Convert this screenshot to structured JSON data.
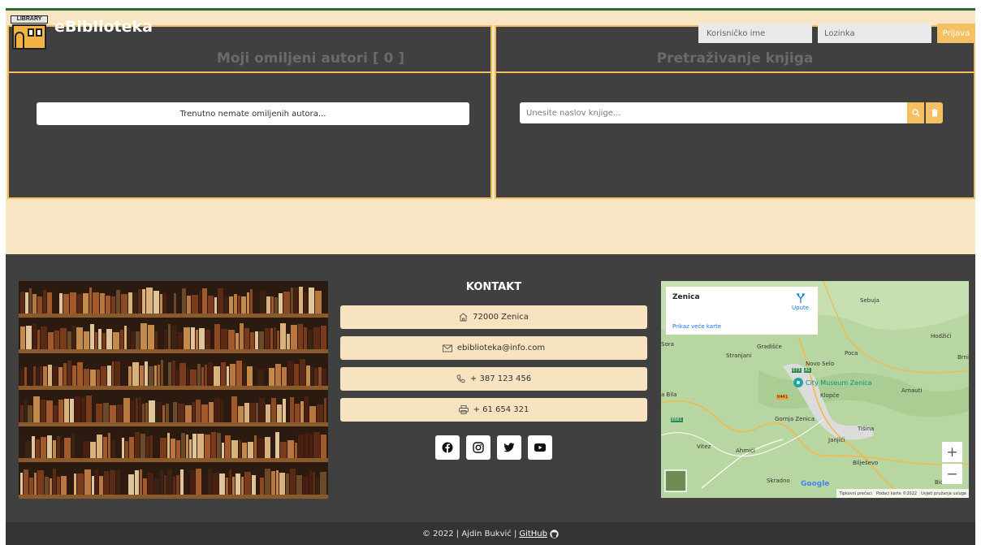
{
  "brand": {
    "logo_tag": "LIBRARY",
    "name": "eBiblioteka"
  },
  "login": {
    "username_placeholder": "Korisničko ime",
    "password_placeholder": "Lozinka",
    "button": "Prijava"
  },
  "favorites": {
    "title": "Moji omiljeni autori [ 0 ]",
    "empty_message": "Trenutno nemate omiljenih autora..."
  },
  "search": {
    "title": "Pretraživanje knjiga",
    "placeholder": "Unesite naslov knjige...",
    "search_icon": "search-icon",
    "clear_icon": "trash-icon"
  },
  "contact": {
    "title": "KONTAKT",
    "items": [
      {
        "icon": "home-icon",
        "text": "72000 Zenica"
      },
      {
        "icon": "envelope-icon",
        "text": "ebiblioteka@info.com"
      },
      {
        "icon": "phone-icon",
        "text": "+ 387 123 456"
      },
      {
        "icon": "printer-icon",
        "text": "+ 61 654 321"
      }
    ],
    "socials": [
      "facebook-icon",
      "instagram-icon",
      "twitter-icon",
      "youtube-icon"
    ]
  },
  "map": {
    "place": "Zenica",
    "directions": "Upute",
    "larger_map": "Prikaz veće karte",
    "labels": {
      "sebuja": "Sebuja",
      "hodzici": "Hodžići",
      "brni": "Brni",
      "sora": "Sora",
      "stranjani": "Stranjani",
      "gradisce": "Gradišće",
      "poca": "Poca",
      "novo_selo": "Novo Selo",
      "museum": "City Museum Zenica",
      "arnauti": "Arnauti",
      "bila": "a Bila",
      "klopce": "Klopče",
      "gornja_zenica": "Gornja Zenica",
      "tisina": "Tišina",
      "janjici": "Janjići",
      "vitez": "Vitez",
      "ahmici": "Ahmići",
      "bilesevo": "Bilješevo",
      "skradno": "Skradno",
      "bice": "Biće",
      "road_e73": "E73",
      "road_a1": "A1",
      "road_r441": "R441",
      "road_e661": "E661"
    },
    "attribution": {
      "logo": "Google",
      "shortcuts": "Tipkovni prečaci",
      "data": "Podaci karte ©2022",
      "terms": "Uvjeti pružanja usluge"
    },
    "zoom_in": "+",
    "zoom_out": "−"
  },
  "footer": {
    "copyright": "© 2022 | Ajdin Bukvić |",
    "github": "GitHub"
  },
  "colors": {
    "accent": "#f4c061",
    "panel": "#404040",
    "cream": "#f8e5c4"
  }
}
